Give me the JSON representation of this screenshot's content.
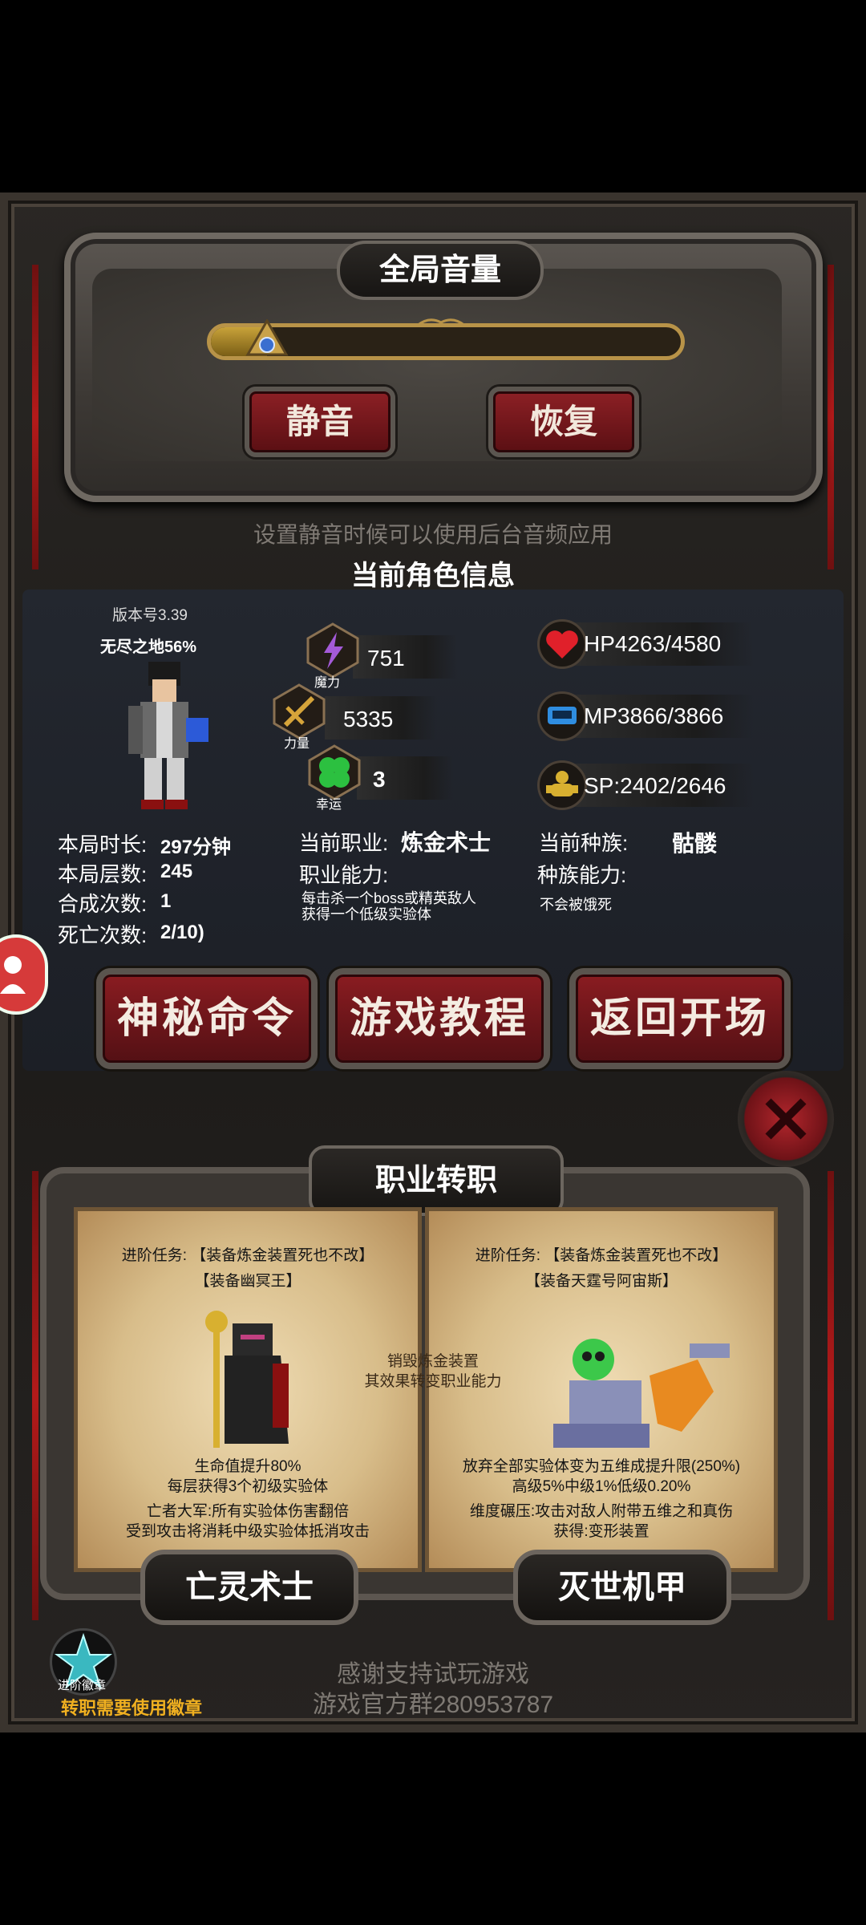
{
  "volume": {
    "title": "全局音量",
    "level_percent": 12,
    "mute_label": "静音",
    "restore_label": "恢复",
    "hint": "设置静音时候可以使用后台音频应用"
  },
  "character": {
    "section_title": "当前角色信息",
    "version": "版本号3.39",
    "zone": "无尽之地56%",
    "stats": {
      "magic": {
        "value": "751",
        "label": "魔力"
      },
      "strength": {
        "value": "5335",
        "label": "力量"
      },
      "luck": {
        "value": "3",
        "label": "幸运"
      },
      "hp": "HP4263/4580",
      "mp": "MP3866/3866",
      "sp": "SP:2402/2646"
    },
    "run_time_label": "本局时长:",
    "run_time_value": "297分钟",
    "floors_label": "本局层数:",
    "floors_value": "245",
    "synth_label": "合成次数:",
    "synth_value": "1",
    "death_label": "死亡次数:",
    "death_value": "2/10)",
    "job_label": "当前职业:",
    "job_value": "炼金术士",
    "job_ability_label": "职业能力:",
    "job_ability_desc1": "每击杀一个boss或精英敌人",
    "job_ability_desc2": "获得一个低级实验体",
    "race_label": "当前种族:",
    "race_value": "骷髅",
    "race_ability_label": "种族能力:",
    "race_ability_desc": "不会被饿死"
  },
  "menu": {
    "secret_command": "神秘命令",
    "tutorial": "游戏教程",
    "back_to_start": "返回开场"
  },
  "class_change": {
    "title": "职业转职",
    "center_note1": "销毁炼金装置",
    "center_note2": "其效果转变职业能力",
    "left": {
      "quest_label": "进阶任务:",
      "quest1": "【装备炼金装置死也不改】",
      "quest2": "【装备幽冥王】",
      "desc1": "生命值提升80%",
      "desc2": "每层获得3个初级实验体",
      "desc3": "亡者大军:所有实验体伤害翻倍",
      "desc4": "受到攻击将消耗中级实验体抵消攻击",
      "name": "亡灵术士"
    },
    "right": {
      "quest_label": "进阶任务:",
      "quest1": "【装备炼金装置死也不改】",
      "quest2": "【装备天霆号阿宙斯】",
      "desc1": "放弃全部实验体变为五维成提升限(250%)",
      "desc2": "高级5%中级1%低级0.20%",
      "desc3": "维度碾压:攻击对敌人附带五维之和真伤",
      "desc4": "获得:变形装置",
      "name": "灭世机甲"
    }
  },
  "badge": {
    "icon_label": "进阶徽章",
    "note": "转职需要使用徽章"
  },
  "footer": {
    "thanks": "感谢支持试玩游戏",
    "group": "游戏官方群280953787"
  },
  "colors": {
    "accent_red": "#8a1c21",
    "gold": "#b89348",
    "badge_text": "#f0b020"
  },
  "icons": {
    "magic": "lightning-icon",
    "strength": "sword-icon",
    "luck": "clover-icon",
    "hp": "heart-icon",
    "mp": "mana-device-icon",
    "sp": "stamina-icon",
    "close": "close-icon",
    "avatar": "user-icon",
    "badge": "star-badge-icon"
  }
}
